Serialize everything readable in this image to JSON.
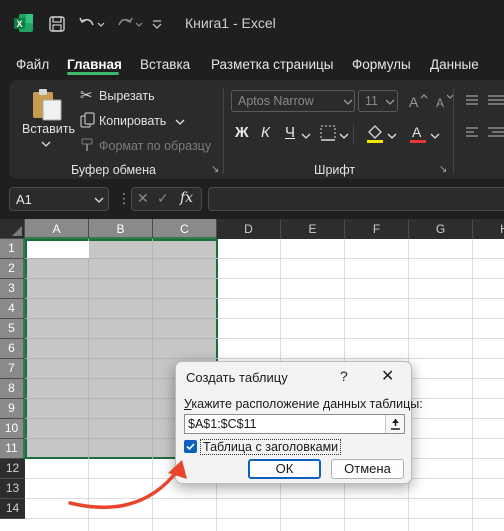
{
  "titlebar": {
    "title": "Книга1  -  Excel",
    "icons": [
      "excel-logo",
      "save-icon",
      "undo-icon",
      "redo-icon",
      "customize-icon"
    ]
  },
  "tabs": [
    "Файл",
    "Главная",
    "Вставка",
    "Разметка страницы",
    "Формулы",
    "Данные"
  ],
  "active_tab": "Главная",
  "ribbon": {
    "clipboard": {
      "paste": "Вставить",
      "cut": "Вырезать",
      "copy": "Копировать",
      "format_painter": "Формат по образцу",
      "group_label": "Буфер обмена"
    },
    "font": {
      "font_name": "Aptos Narrow",
      "font_size": "11",
      "bold": "Ж",
      "italic": "К",
      "underline": "Ч",
      "group_label": "Шрифт"
    }
  },
  "formula_bar": {
    "name_box": "A1",
    "fx": "fx",
    "formula": ""
  },
  "grid": {
    "columns": [
      "A",
      "B",
      "C",
      "D",
      "E",
      "F",
      "G",
      "H"
    ],
    "rows": [
      "1",
      "2",
      "3",
      "4",
      "5",
      "6",
      "7",
      "8",
      "9",
      "10",
      "11",
      "12",
      "13",
      "14"
    ],
    "selected_columns": [
      "A",
      "B",
      "C"
    ],
    "selected_rows": [
      "1",
      "2",
      "3",
      "4",
      "5",
      "6",
      "7",
      "8",
      "9",
      "10",
      "11"
    ]
  },
  "dialog": {
    "title": "Создать таблицу",
    "help": "?",
    "close": "✕",
    "prompt_underlined": "У",
    "prompt_rest": "кажите расположение данных таблицы:",
    "range_value": "$A$1:$C$11",
    "checkbox_label": "Таблица с заголовками",
    "checkbox_checked": true,
    "ok_label": "ОК",
    "cancel_label": "Отмена"
  },
  "colors": {
    "accent_green": "#3dbb6b",
    "selection_border": "#1e6b3e",
    "arrow_red": "#e8452c",
    "check_blue": "#0f5fbf"
  }
}
